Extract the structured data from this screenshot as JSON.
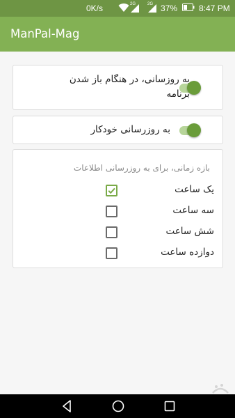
{
  "status_bar": {
    "network_speed": "0K/s",
    "network_label_1": "2G",
    "network_label_2": "2G",
    "battery_percent": "37%",
    "time": "8:47 PM"
  },
  "app_bar": {
    "title": "ManPal-Mag"
  },
  "settings": {
    "update_on_open": {
      "label": "به روزسانی، در هنگام باز شدن برنامه",
      "enabled": true
    },
    "auto_update": {
      "label": "به روزرسانی خودکار",
      "enabled": true
    },
    "interval": {
      "title": "بازه زمانی، برای به روزرسانی اطلاعات",
      "options": [
        {
          "label": "یک ساعت",
          "checked": true
        },
        {
          "label": "سه ساعت",
          "checked": false
        },
        {
          "label": "شش ساعت",
          "checked": false
        },
        {
          "label": "دوازده ساعت",
          "checked": false
        }
      ]
    }
  },
  "colors": {
    "primary": "#83b154",
    "status_bar": "#6e9544",
    "accent": "#6a9c3a"
  },
  "icons": {
    "nav": [
      "back-icon",
      "home-icon",
      "recents-icon"
    ]
  }
}
